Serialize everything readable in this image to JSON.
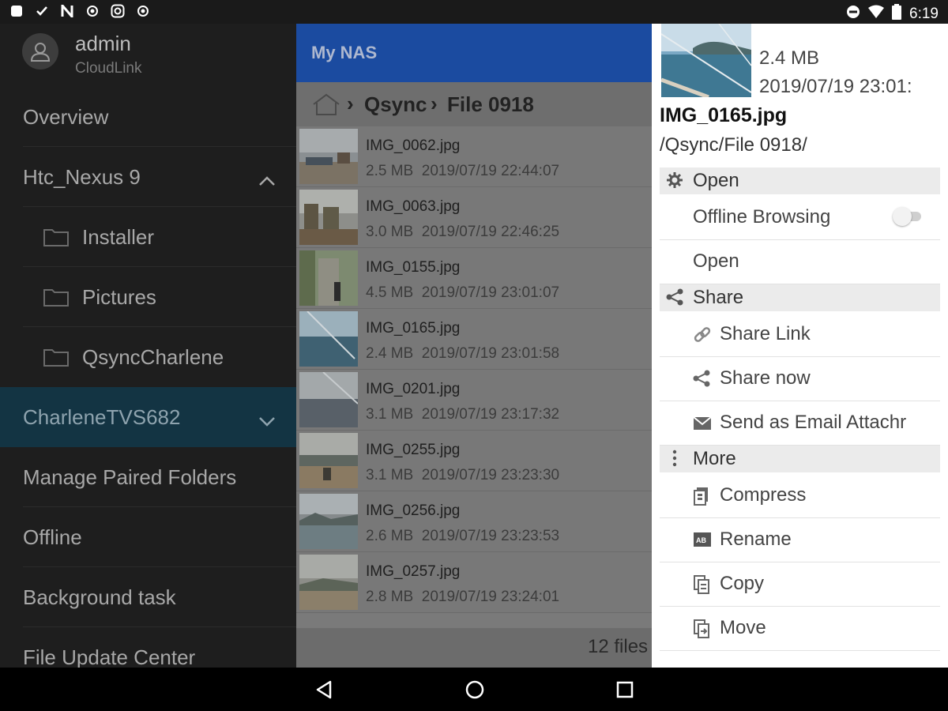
{
  "status_bar": {
    "time": "6:19"
  },
  "drawer": {
    "user": {
      "name": "admin",
      "subtitle": "CloudLink"
    },
    "items": [
      {
        "label": "Overview"
      },
      {
        "label": "Htc_Nexus 9"
      },
      {
        "label": "Installer"
      },
      {
        "label": "Pictures"
      },
      {
        "label": "QsyncCharlene"
      },
      {
        "label": "CharleneTVS682"
      },
      {
        "label": "Manage Paired Folders"
      },
      {
        "label": "Offline"
      },
      {
        "label": "Background task"
      },
      {
        "label": "File Update Center"
      }
    ]
  },
  "main": {
    "title": "My NAS",
    "breadcrumb": [
      "Qsync",
      "File 0918"
    ],
    "files": [
      {
        "name": "IMG_0062.jpg",
        "size": "2.5 MB",
        "date": "2019/07/19 22:44:07"
      },
      {
        "name": "IMG_0063.jpg",
        "size": "3.0 MB",
        "date": "2019/07/19 22:46:25"
      },
      {
        "name": "IMG_0155.jpg",
        "size": "4.5 MB",
        "date": "2019/07/19 23:01:07"
      },
      {
        "name": "IMG_0165.jpg",
        "size": "2.4 MB",
        "date": "2019/07/19 23:01:58"
      },
      {
        "name": "IMG_0201.jpg",
        "size": "3.1 MB",
        "date": "2019/07/19 23:17:32"
      },
      {
        "name": "IMG_0255.jpg",
        "size": "3.1 MB",
        "date": "2019/07/19 23:23:30"
      },
      {
        "name": "IMG_0256.jpg",
        "size": "2.6 MB",
        "date": "2019/07/19 23:23:53"
      },
      {
        "name": "IMG_0257.jpg",
        "size": "2.8 MB",
        "date": "2019/07/19 23:24:01"
      }
    ],
    "file_count": "12 files"
  },
  "details": {
    "size": "2.4 MB",
    "date": "2019/07/19 23:01:",
    "name": "IMG_0165.jpg",
    "path": "/Qsync/File 0918/",
    "sections": {
      "open": "Open",
      "share": "Share",
      "more": "More"
    },
    "actions": {
      "offline_browsing": "Offline Browsing",
      "open": "Open",
      "share_link": "Share Link",
      "share_now": "Share now",
      "send_email": "Send as Email Attachr",
      "compress": "Compress",
      "rename": "Rename",
      "copy": "Copy",
      "move": "Move"
    },
    "offline_browsing_enabled": false
  }
}
